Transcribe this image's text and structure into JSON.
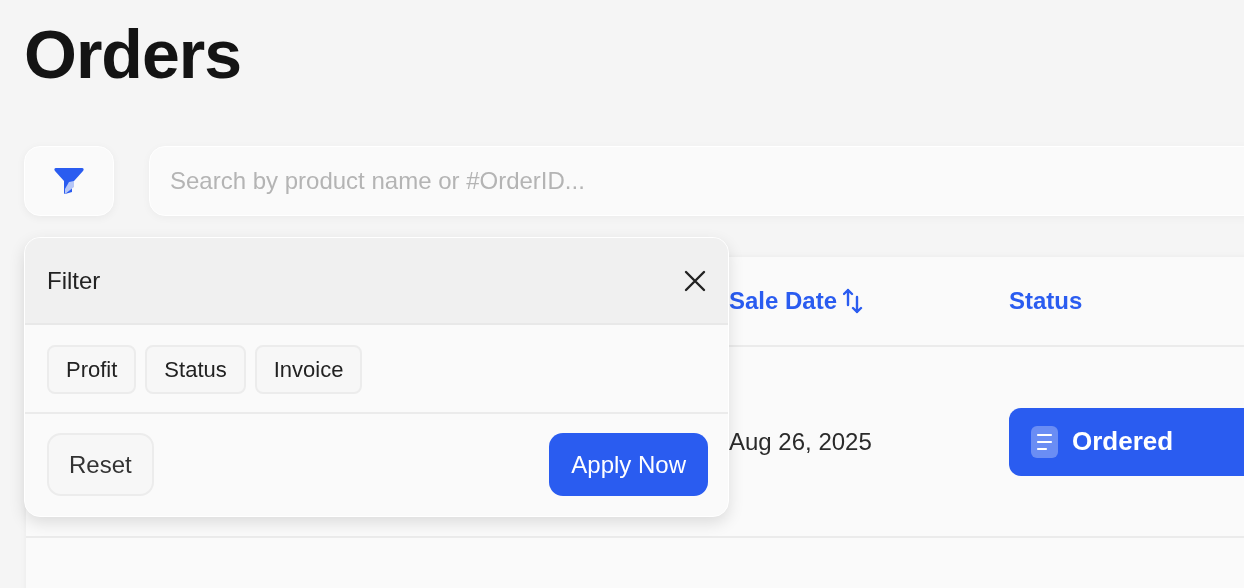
{
  "page": {
    "title": "Orders"
  },
  "search": {
    "placeholder": "Search by product name or #OrderID..."
  },
  "table": {
    "columns": [
      {
        "label": "Sale Date",
        "sortable": true
      },
      {
        "label": "Status",
        "sortable": false
      }
    ],
    "rows": [
      {
        "sale_date": "Aug 26, 2025",
        "status": {
          "label": "Ordered",
          "kind": "ordered"
        }
      }
    ]
  },
  "filter_popover": {
    "title": "Filter",
    "options": [
      {
        "label": "Profit",
        "selected": false
      },
      {
        "label": "Status",
        "selected": false
      },
      {
        "label": "Invoice",
        "selected": false
      }
    ],
    "buttons": [
      {
        "label": "Reset",
        "kind": "secondary"
      },
      {
        "label": "Apply Now",
        "kind": "primary"
      }
    ]
  }
}
